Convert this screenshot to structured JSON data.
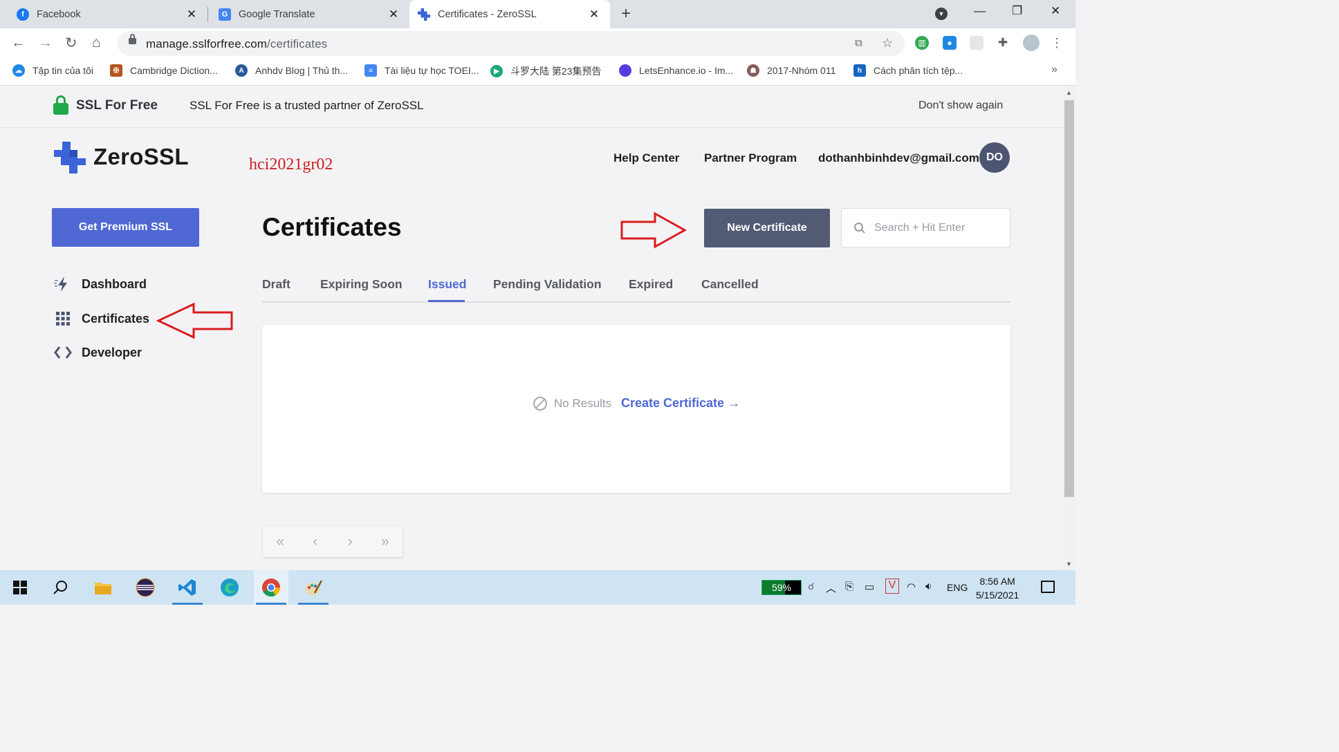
{
  "browser": {
    "tabs": [
      {
        "title": "Facebook",
        "favicon": "facebook-icon",
        "active": false
      },
      {
        "title": "Google Translate",
        "favicon": "google-translate-icon",
        "active": false
      },
      {
        "title": "Certificates - ZeroSSL",
        "favicon": "zerossl-icon",
        "active": true
      }
    ],
    "url_host": "manage.sslforfree.com",
    "url_path": "/certificates",
    "bookmarks": [
      {
        "label": "Tập tin của tôi",
        "icon": "cloud-icon",
        "color": "#1e88e5"
      },
      {
        "label": "Cambridge Diction...",
        "icon": "cambridge-shield-icon",
        "color": "#b3541e"
      },
      {
        "label": "Anhdv Blog | Thủ th...",
        "icon": "anhdv-blog-icon",
        "color": "#2a5a9a"
      },
      {
        "label": "Tài liệu tự học TOEI...",
        "icon": "docs-icon",
        "color": "#4285f4"
      },
      {
        "label": "斗罗大陆 第23集预告",
        "icon": "play-icon",
        "color": "#19a974"
      },
      {
        "label": "LetsEnhance.io - Im...",
        "icon": "letsenhance-icon",
        "color": "#5a3be0"
      },
      {
        "label": "2017-Nhóm 011",
        "icon": "figure-icon",
        "color": "#8a5a5a"
      },
      {
        "label": "Cách phân tích tệp...",
        "icon": "h-icon",
        "color": "#1565c0"
      }
    ]
  },
  "banner": {
    "brand": "SSL For Free",
    "message": "SSL For Free is a trusted partner of ZeroSSL",
    "dismiss": "Don't show again"
  },
  "header": {
    "logo_text": "ZeroSSL",
    "annotation": "hci2021gr02",
    "links": [
      "Help Center",
      "Partner Program"
    ],
    "email": "dothanhbinhdev@gmail.com",
    "avatar_initials": "DO"
  },
  "sidebar": {
    "premium_button": "Get Premium SSL",
    "items": [
      {
        "label": "Dashboard",
        "icon": "lightning-icon"
      },
      {
        "label": "Certificates",
        "icon": "grid-icon"
      },
      {
        "label": "Developer",
        "icon": "code-icon"
      }
    ]
  },
  "main": {
    "title": "Certificates",
    "new_button": "New Certificate",
    "search_placeholder": "Search + Hit Enter",
    "tabs": [
      "Draft",
      "Expiring Soon",
      "Issued",
      "Pending Validation",
      "Expired",
      "Cancelled"
    ],
    "active_tab": "Issued",
    "empty_text": "No Results",
    "create_link": "Create Certificate →",
    "pager": [
      "«",
      "‹",
      "›",
      "»"
    ]
  },
  "taskbar": {
    "battery": "59%",
    "battery_level": 0.59,
    "language": "ENG",
    "time": "8:56 AM",
    "date": "5/15/2021"
  },
  "colors": {
    "accent": "#4f68d4",
    "new_button": "#535a74",
    "annotation_red": "#d91c1c"
  }
}
